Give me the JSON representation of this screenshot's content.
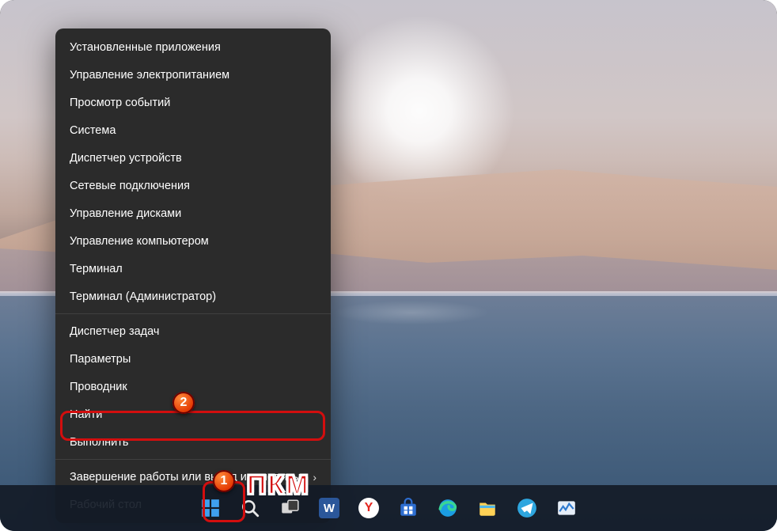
{
  "menu": {
    "items": [
      "Установленные приложения",
      "Управление электропитанием",
      "Просмотр событий",
      "Система",
      "Диспетчер устройств",
      "Сетевые подключения",
      "Управление дисками",
      "Управление компьютером",
      "Терминал",
      "Терминал (Администратор)"
    ],
    "items2": [
      "Диспетчер задач",
      "Параметры",
      "Проводник",
      "Найти",
      "Выполнить"
    ],
    "shutdown": "Завершение работы или выход из системы",
    "desktop": "Рабочий стол"
  },
  "annotations": {
    "badge1": "1",
    "badge2": "2",
    "rmb": "ПКМ"
  },
  "taskbar": {
    "icons": [
      {
        "name": "start-icon"
      },
      {
        "name": "search-icon"
      },
      {
        "name": "taskview-icon"
      },
      {
        "name": "word-icon",
        "letter": "W",
        "bg": "#2b579a"
      },
      {
        "name": "yandex-icon",
        "letter": "Y",
        "bg": "#ffffff",
        "fg": "#e52620"
      },
      {
        "name": "store-icon"
      },
      {
        "name": "edge-icon"
      },
      {
        "name": "explorer-icon"
      },
      {
        "name": "telegram-icon"
      },
      {
        "name": "monitor-icon"
      }
    ]
  },
  "colors": {
    "accent": "#d30e0e",
    "menu_bg": "#2b2b2b",
    "taskbar_bg": "#121a26"
  }
}
